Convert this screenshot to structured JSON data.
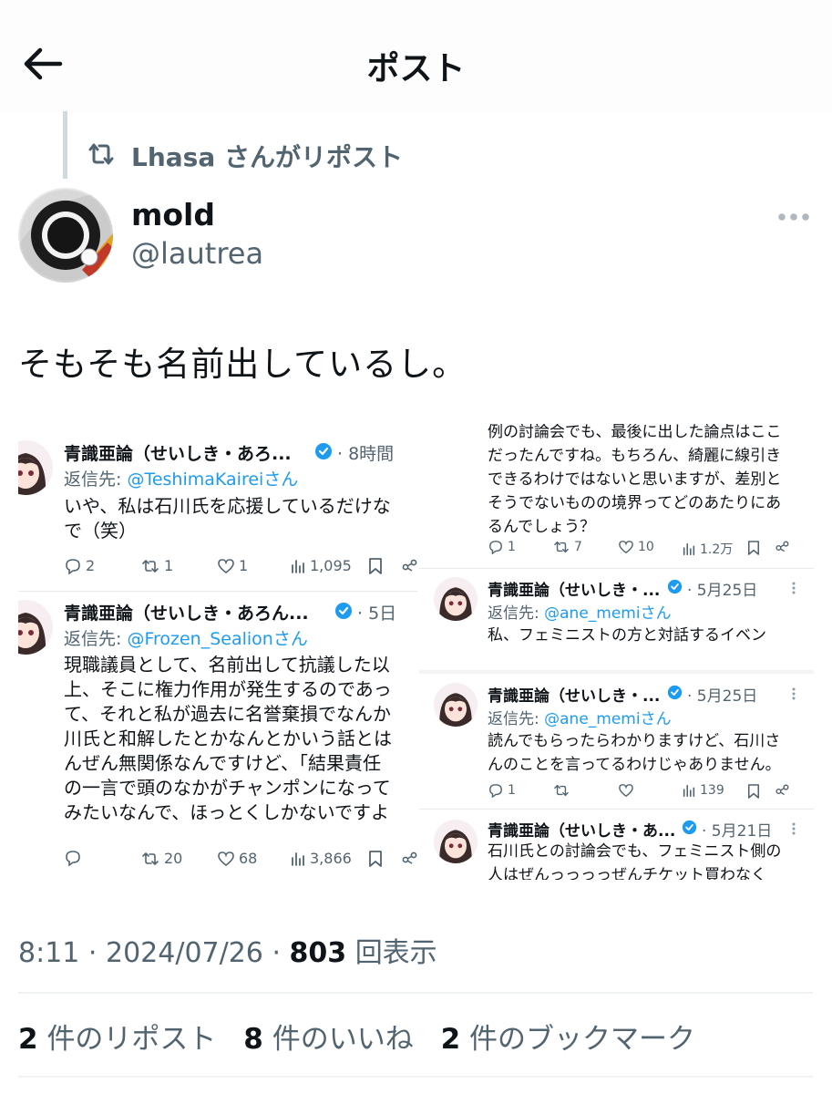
{
  "header": {
    "title": "ポスト",
    "back_icon": "arrow-left-icon"
  },
  "repost": {
    "text": "Lhasa さんがリポスト",
    "icon": "repost-icon"
  },
  "author": {
    "name": "mold",
    "handle": "@lautrea",
    "more_icon": "more-icon"
  },
  "post": {
    "text": "そもそも名前出しているし。"
  },
  "screenshot_left": {
    "tweets": [
      {
        "name": "青識亜論（せいしき・あろ...",
        "time": "· 8時間",
        "reply_prefix": "返信先: ",
        "reply_to": "@TeshimaKaireiさん",
        "lines": [
          "いや、私は石川氏を応援しているだけな",
          "で（笑）"
        ],
        "replies": "2",
        "reposts": "1",
        "likes": "1",
        "views": "1,095"
      },
      {
        "name": "青識亜論（せいしき・あろん...",
        "time": "· 5日",
        "reply_prefix": "返信先: ",
        "reply_to": "@Frozen_Sealionさん",
        "lines": [
          "現職議員として、名前出して抗議した以",
          "上、そこに権力作用が発生するのであっ",
          "て、それと私が過去に名誉棄損でなんか",
          "川氏と和解したとかなんとかいう話とは",
          "んぜん無関係なんですけど、「結果責任",
          "の一言で頭のなかがチャンポンになって",
          "みたいなんで、ほっとくしかないですよ"
        ],
        "replies": "",
        "reposts": "20",
        "likes": "68",
        "views": "3,866"
      }
    ]
  },
  "screenshot_right": {
    "top": {
      "lines": [
        "例の討論会でも、最後に出した論点はここ",
        "だったんですね。もちろん、綺麗に線引き",
        "できるわけではないと思いますが、差別と",
        "そうでないものの境界ってどのあたりにあ",
        "るんでしょう？"
      ],
      "replies": "1",
      "reposts": "7",
      "likes": "10",
      "views": "1.2万"
    },
    "tweets": [
      {
        "name": "青識亜論（せいしき・...",
        "time": "· 5月25日",
        "reply_prefix": "返信先: ",
        "reply_to": "@ane_memiさん",
        "lines": [
          "私、フェミニストの方と対話するイベン"
        ]
      },
      {
        "name": "青識亜論（せいしき・...",
        "time": "· 5月25日",
        "reply_prefix": "返信先: ",
        "reply_to": "@ane_memiさん",
        "lines": [
          "読んでもらったらわかりますけど、石川さ",
          "んのことを言ってるわけじゃありません。"
        ],
        "replies": "1",
        "reposts": "",
        "likes": "",
        "views": "139"
      },
      {
        "name": "青識亜論（せいしき・あ...",
        "time": "· 5月21日",
        "lines": [
          "石川氏との討論会でも、フェミニスト側の",
          "人はぜんっっっっぜんチケット買わなく"
        ]
      }
    ]
  },
  "meta": {
    "time": "8:11",
    "date": "2024/07/26",
    "views": "803",
    "views_label": "回表示"
  },
  "stats": {
    "reposts_count": "2",
    "reposts_label": "件のリポスト",
    "likes_count": "8",
    "likes_label": "件のいいね",
    "bookmarks_count": "2",
    "bookmarks_label": "件のブックマーク"
  },
  "colors": {
    "accent": "#1d9bf0",
    "secondary_text": "#536471",
    "text": "#0f1419"
  }
}
